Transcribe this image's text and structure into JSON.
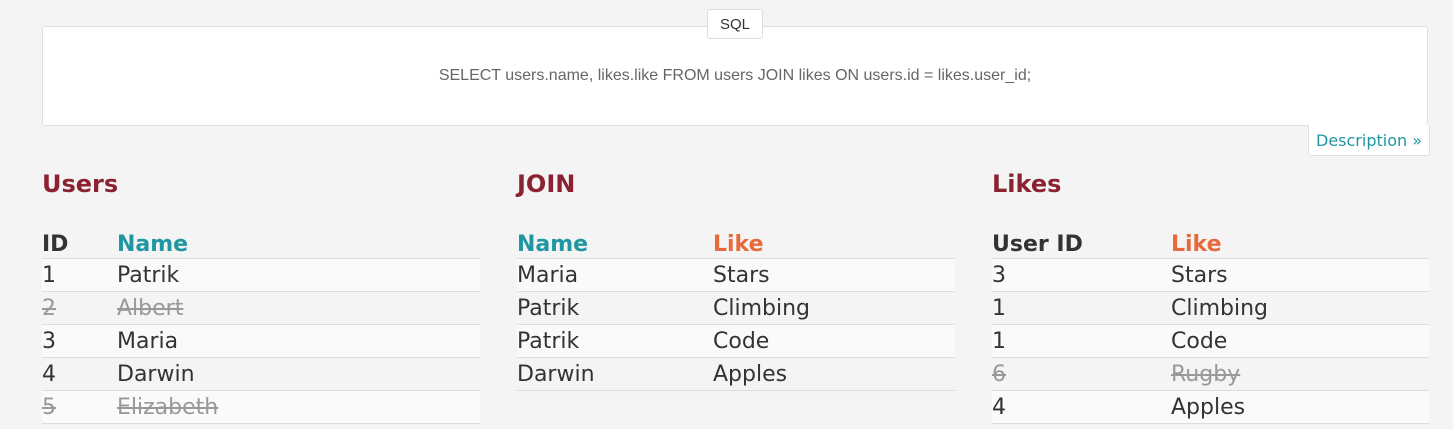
{
  "sql": {
    "tag": "SQL",
    "query": "SELECT users.name, likes.like FROM users JOIN likes ON users.id = likes.user_id;",
    "description_link": "Description »"
  },
  "users": {
    "title": "Users",
    "headers": [
      "ID",
      "Name"
    ],
    "rows": [
      {
        "id": "1",
        "name": "Patrik",
        "struck": false
      },
      {
        "id": "2",
        "name": "Albert",
        "struck": true
      },
      {
        "id": "3",
        "name": "Maria",
        "struck": false
      },
      {
        "id": "4",
        "name": "Darwin",
        "struck": false
      },
      {
        "id": "5",
        "name": "Elizabeth",
        "struck": true
      }
    ]
  },
  "join": {
    "title": "JOIN",
    "headers": [
      "Name",
      "Like"
    ],
    "rows": [
      {
        "name": "Maria",
        "like": "Stars"
      },
      {
        "name": "Patrik",
        "like": "Climbing"
      },
      {
        "name": "Patrik",
        "like": "Code"
      },
      {
        "name": "Darwin",
        "like": "Apples"
      }
    ]
  },
  "likes": {
    "title": "Likes",
    "headers": [
      "User ID",
      "Like"
    ],
    "rows": [
      {
        "user_id": "3",
        "like": "Stars",
        "struck": false
      },
      {
        "user_id": "1",
        "like": "Climbing",
        "struck": false
      },
      {
        "user_id": "1",
        "like": "Code",
        "struck": false
      },
      {
        "user_id": "6",
        "like": "Rugby",
        "struck": true
      },
      {
        "user_id": "4",
        "like": "Apples",
        "struck": false
      }
    ]
  },
  "colors": {
    "heading": "#8b2232",
    "name_column": "#1f97a3",
    "like_column": "#e86a3c",
    "link": "#1f97a3"
  }
}
